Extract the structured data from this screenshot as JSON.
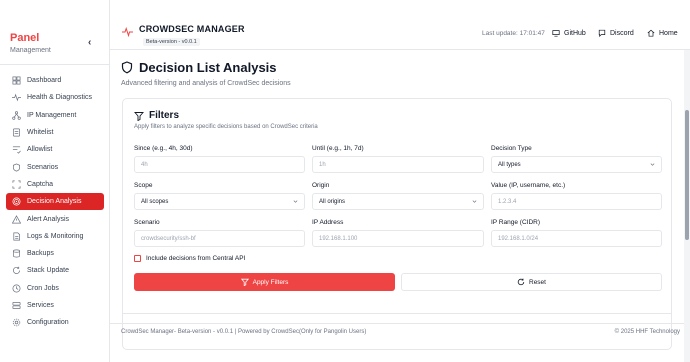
{
  "sidebar": {
    "title": "Panel",
    "subtitle": "Management",
    "items": [
      {
        "label": "Dashboard",
        "icon": "dashboard-icon",
        "active": false
      },
      {
        "label": "Health & Diagnostics",
        "icon": "activity-icon",
        "active": false
      },
      {
        "label": "IP Management",
        "icon": "network-icon",
        "active": false
      },
      {
        "label": "Whitelist",
        "icon": "list-icon",
        "active": false
      },
      {
        "label": "Allowlist",
        "icon": "list-check-icon",
        "active": false
      },
      {
        "label": "Scenarios",
        "icon": "shield-icon",
        "active": false
      },
      {
        "label": "Captcha",
        "icon": "captcha-icon",
        "active": false
      },
      {
        "label": "Decision Analysis",
        "icon": "target-icon",
        "active": true
      },
      {
        "label": "Alert Analysis",
        "icon": "alert-icon",
        "active": false
      },
      {
        "label": "Logs & Monitoring",
        "icon": "file-text-icon",
        "active": false
      },
      {
        "label": "Backups",
        "icon": "database-icon",
        "active": false
      },
      {
        "label": "Stack Update",
        "icon": "refresh-icon",
        "active": false
      },
      {
        "label": "Cron Jobs",
        "icon": "clock-icon",
        "active": false
      },
      {
        "label": "Services",
        "icon": "server-icon",
        "active": false
      },
      {
        "label": "Configuration",
        "icon": "settings-icon",
        "active": false
      }
    ]
  },
  "header": {
    "app_title": "CROWDSEC MANAGER",
    "version": "Beta-version - v0.0.1",
    "last_update": "Last update: 17:01:47",
    "links": [
      "GitHub",
      "Discord",
      "Home"
    ]
  },
  "main": {
    "title": "Decision List Analysis",
    "subtitle": "Advanced filtering and analysis of CrowdSec decisions"
  },
  "filters": {
    "title": "Filters",
    "subtitle": "Apply filters to analyze specific decisions based on CrowdSec criteria",
    "since_label": "Since (e.g., 4h, 30d)",
    "since_placeholder": "4h",
    "until_label": "Until (e.g., 1h, 7d)",
    "until_placeholder": "1h",
    "type_label": "Decision Type",
    "type_value": "All types",
    "scope_label": "Scope",
    "scope_value": "All scopes",
    "origin_label": "Origin",
    "origin_value": "All origins",
    "value_label": "Value (IP, username, etc.)",
    "value_placeholder": "1.2.3.4",
    "scenario_label": "Scenario",
    "scenario_placeholder": "crowdsecurity/ssh-bf",
    "ip_label": "IP Address",
    "ip_placeholder": "192.168.1.100",
    "range_label": "IP Range (CIDR)",
    "range_placeholder": "192.168.1.0/24",
    "central_api_label": "Include decisions from Central API",
    "apply_label": "Apply Filters",
    "reset_label": "Reset"
  },
  "footer": {
    "left": "CrowdSec Manager- Beta-version - v0.0.1   |   Powered by CrowdSec(Only for Pangolin Users)",
    "right": "© 2025 HHF Technology"
  },
  "colors": {
    "accent": "#ef4444",
    "active_nav": "#dc2626"
  }
}
